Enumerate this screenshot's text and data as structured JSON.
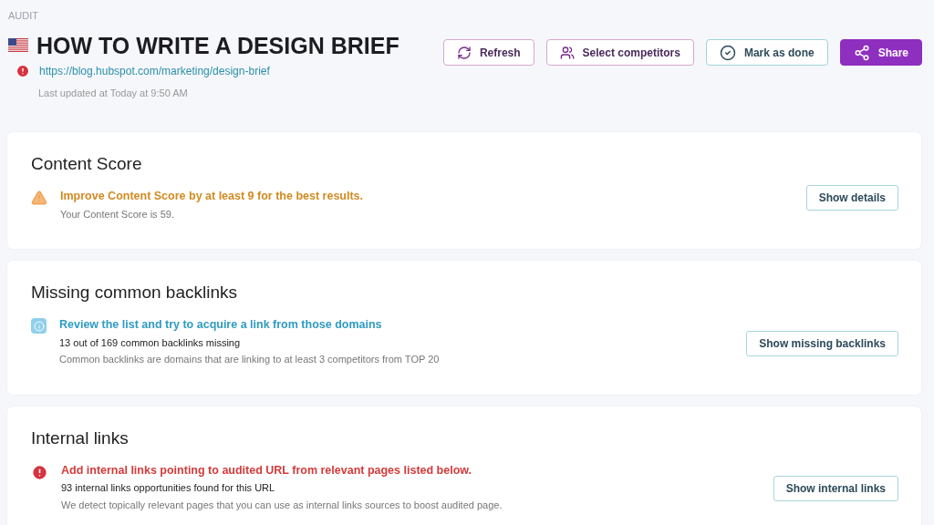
{
  "breadcrumb": "AUDIT",
  "title": "HOW TO WRITE A DESIGN BRIEF",
  "url": "https://blog.hubspot.com/marketing/design-brief",
  "last_updated": "Last updated at Today at 9:50 AM",
  "actions": [
    {
      "label": "Refresh",
      "kind": "outline"
    },
    {
      "label": "Select competitors",
      "kind": "outline"
    },
    {
      "label": "Mark as done",
      "kind": "teal"
    },
    {
      "label": "Share",
      "kind": "primary"
    }
  ],
  "sections": [
    {
      "title": "Content Score",
      "alert": {
        "kind": "warning",
        "message": "Improve Content Score by at least 9 for the best results.",
        "lines": [
          {
            "kind": "note",
            "text": "Your Content Score is 59."
          }
        ]
      },
      "button": "Show details"
    },
    {
      "title": "Missing common backlinks",
      "alert": {
        "kind": "info",
        "message": "Review the list and try to acquire a link from those domains",
        "lines": [
          {
            "kind": "count",
            "text": "13 out of 169 common backlinks missing"
          },
          {
            "kind": "note",
            "text": "Common backlinks are domains that are linking to at least 3 competitors from TOP 20"
          }
        ]
      },
      "button": "Show missing backlinks"
    },
    {
      "title": "Internal links",
      "alert": {
        "kind": "error",
        "message": "Add internal links pointing to audited URL from relevant pages listed below.",
        "lines": [
          {
            "kind": "count",
            "text": "93 internal links opportunities found for this URL"
          },
          {
            "kind": "note",
            "text": "We detect topically relevant pages that you can use as internal links sources to boost audited page."
          }
        ]
      },
      "button": "Show internal links"
    }
  ]
}
